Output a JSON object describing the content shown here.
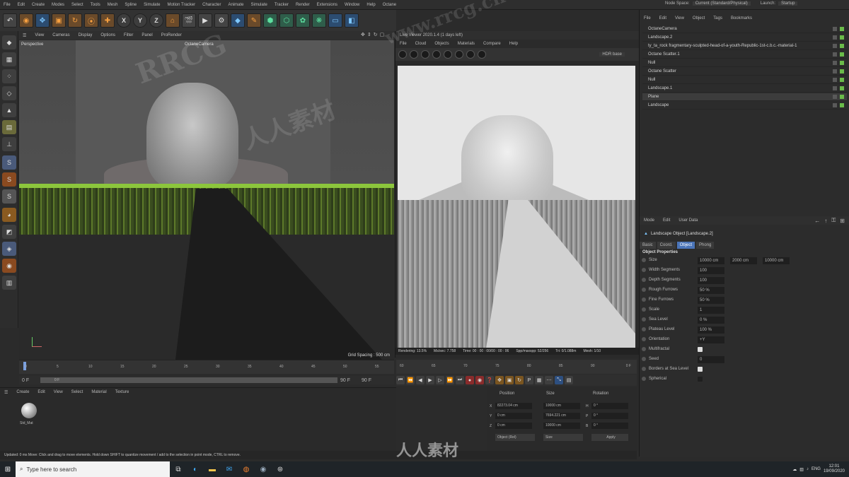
{
  "menubar": [
    "File",
    "Edit",
    "Create",
    "Modes",
    "Select",
    "Tools",
    "Mesh",
    "Spline",
    "Simulate",
    "Motion Tracker",
    "Character",
    "Animate",
    "Simulate",
    "Tracker",
    "Render",
    "Extensions",
    "Window",
    "Help",
    "Octane"
  ],
  "node_space": {
    "label": "Node Space:",
    "value": "Current (Standard/Physical)"
  },
  "launch": {
    "label": "Launch:",
    "value": "Startup"
  },
  "viewport": {
    "menu": [
      "View",
      "Cameras",
      "Display",
      "Options",
      "Filter",
      "Panel",
      "ProRender"
    ],
    "label": "Perspective",
    "camera": "OctaneCamera",
    "grid_spacing": "Grid Spacing : 500 cm"
  },
  "timeline": {
    "ticks": [
      "0",
      "5",
      "10",
      "15",
      "20",
      "25",
      "30",
      "35",
      "40",
      "45",
      "50",
      "55",
      "60",
      "65",
      "70",
      "75",
      "80",
      "85",
      "90"
    ],
    "start_frame": "0 F",
    "current_frame": "0 F",
    "end_frame": "90 F",
    "end_frame2": "90 F",
    "frame_readout": "0 F"
  },
  "live_viewer": {
    "title": "Live Viewer 2020.1.4 (1 days left)",
    "menu": [
      "File",
      "Cloud",
      "Objects",
      "Materials",
      "Compare",
      "Help"
    ],
    "preset": "HDR base",
    "status": [
      "Rendering: 13.5%",
      "Ms/sec: 7.758",
      "Time: 00 : 00 : 00/00 : 00 : 06",
      "Spp/maxspp: 52/256",
      "Tri: 0/1.088m",
      "Mesh: 1/10"
    ]
  },
  "object_manager": {
    "menu": [
      "File",
      "Edit",
      "View",
      "Object",
      "Tags",
      "Bookmarks"
    ],
    "objects": [
      {
        "name": "OctaneCamera",
        "selected": false
      },
      {
        "name": "Landscape.2",
        "selected": false
      },
      {
        "name": "ty_ta_rock fragmentary-sculpted-head-of-a-youth-Republic-1st-c.b.c.-material-1",
        "selected": false
      },
      {
        "name": "Octane Scatter.1",
        "selected": false
      },
      {
        "name": "Null",
        "selected": false
      },
      {
        "name": "Octane Scatter",
        "selected": false
      },
      {
        "name": "Null",
        "selected": false
      },
      {
        "name": "Landscape.1",
        "selected": false
      },
      {
        "name": "Plane",
        "selected": true
      },
      {
        "name": "Landscape",
        "selected": false
      }
    ]
  },
  "attributes": {
    "menu": [
      "Mode",
      "Edit",
      "User Data"
    ],
    "title": "Landscape Object [Landscape.2]",
    "tabs": [
      {
        "label": "Basic",
        "active": false
      },
      {
        "label": "Coord.",
        "active": false
      },
      {
        "label": "Object",
        "active": true
      },
      {
        "label": "Phong",
        "active": false
      }
    ],
    "section": "Object Properties",
    "props": [
      {
        "label": "Size",
        "v1": "10000 cm",
        "v2": "2000 cm",
        "v3": "10000 cm"
      },
      {
        "label": "Width Segments",
        "v1": "100"
      },
      {
        "label": "Depth Segments",
        "v1": "100"
      },
      {
        "label": "Rough Furrows",
        "v1": "50 %"
      },
      {
        "label": "Fine Furrows",
        "v1": "50 %"
      },
      {
        "label": "Scale",
        "v1": "1"
      },
      {
        "label": "Sea Level",
        "v1": "0 %"
      },
      {
        "label": "Plateau Level",
        "v1": "100 %"
      },
      {
        "label": "Orientation",
        "v1": "+Y"
      },
      {
        "label": "Multifractal",
        "check": true
      },
      {
        "label": "Seed",
        "v1": "0"
      },
      {
        "label": "Borders at Sea Level",
        "check": true
      },
      {
        "label": "Spherical",
        "check": false
      }
    ]
  },
  "material_manager": {
    "menu": [
      "Create",
      "Edit",
      "View",
      "Select",
      "Material",
      "Texture"
    ],
    "material": "Std_Mat"
  },
  "coordinates": {
    "headers": [
      "Position",
      "Size",
      "Rotation"
    ],
    "rows": [
      {
        "axis": "X",
        "pos": "82273.04 cm",
        "size": "10000 cm",
        "rot_axis": "H",
        "rot": "0 °"
      },
      {
        "axis": "Y",
        "pos": "0 cm",
        "size": "7694.221 cm",
        "rot_axis": "P",
        "rot": "0 °"
      },
      {
        "axis": "Z",
        "pos": "0 cm",
        "size": "10000 cm",
        "rot_axis": "B",
        "rot": "0 °"
      }
    ],
    "mode1": "Object (Rel)",
    "mode2": "Size",
    "apply": "Apply"
  },
  "statusline": "Updated: 0 ms   Move: Click and drag to move elements. Hold down SHIFT to quantize movement / add to the selection in point mode, CTRL to remove.",
  "taskbar": {
    "search_placeholder": "Type here to search",
    "tray_lang": "ENG",
    "time": "12:01",
    "date": "19/09/2020"
  },
  "watermarks": [
    "RRCG",
    "人人素材",
    "www.rrcg.cn",
    "人人素材"
  ]
}
